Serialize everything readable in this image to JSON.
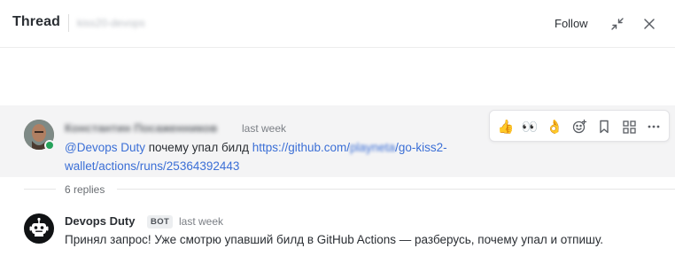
{
  "header": {
    "title": "Thread",
    "channel": "kiss20-devops",
    "follow_label": "Follow",
    "icons": [
      "collapse-icon",
      "close-icon"
    ]
  },
  "root_message": {
    "author": "Константин Посаженников",
    "timestamp": "last week",
    "mention": "@Devops Duty",
    "text": " почему упал билд ",
    "link_part1": "https://github.com/",
    "link_part2": "playneta",
    "link_part3": "/go-kiss2-",
    "link_part4": "wallet/actions/runs/25364392443",
    "toolbar": {
      "reaction_1": "👍",
      "reaction_2": "👀",
      "reaction_3": "👌",
      "icons": [
        "add-reaction-icon",
        "bookmark-icon",
        "apps-icon",
        "more-icon"
      ]
    }
  },
  "replies_label": "6 replies",
  "reply": {
    "author": "Devops Duty",
    "badge": "BOT",
    "timestamp": "last week",
    "text": "Принял запрос! Уже смотрю упавший билд в GitHub Actions — разберусь, почему упал и отпишу."
  },
  "colors": {
    "accent": "#3b6fd6",
    "status_online": "#25a25a",
    "root_bg": "#f4f4f5"
  }
}
